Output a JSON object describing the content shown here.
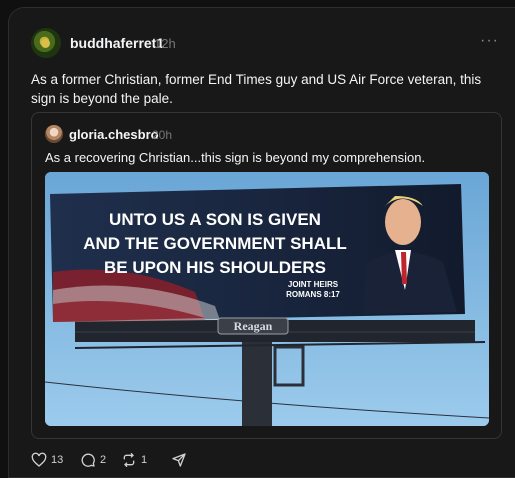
{
  "post": {
    "username": "buddhaferret1",
    "time": "12h",
    "more_label": "···",
    "text": "As a former Christian, former End Times guy and US Air Force veteran, this sign is beyond the pale."
  },
  "quoted": {
    "username": "gloria.chesbro",
    "time": "20h",
    "text": "As a recovering Christian...this sign is beyond my comprehension.",
    "image": {
      "billboard_line1": "UNTO US A SON IS GIVEN",
      "billboard_line2": "AND THE GOVERNMENT SHALL",
      "billboard_line3": "BE UPON HIS SHOULDERS",
      "footnote_line1": "JOINT HEIRS",
      "footnote_line2": "ROMANS 8:17",
      "sign_brand": "Reagan"
    }
  },
  "actions": {
    "likes": "13",
    "replies": "2",
    "reposts": "1"
  },
  "icons": {
    "like": "heart-icon",
    "reply": "comment-icon",
    "repost": "repost-icon",
    "share": "share-icon",
    "more": "more-icon"
  },
  "colors": {
    "background": "#101010",
    "card": "#181818",
    "text": "#f3f5f7",
    "muted": "#777777"
  }
}
